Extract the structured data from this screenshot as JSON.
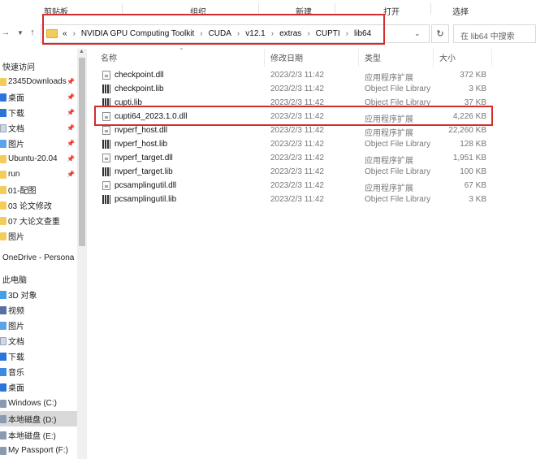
{
  "ribbon": {
    "groups": [
      "剪贴板",
      "组织",
      "新建",
      "打开",
      "选择"
    ]
  },
  "address": {
    "overflow": "«",
    "breadcrumbs": [
      "NVIDIA GPU Computing Toolkit",
      "CUDA",
      "v12.1",
      "extras",
      "CUPTI",
      "lib64"
    ],
    "search_placeholder": "在 lib64 中搜索"
  },
  "sidebar": {
    "quick_access_label": "快速访问",
    "quick_items": [
      {
        "label": "2345Downloads",
        "icon": "folder-icon",
        "pinned": true
      },
      {
        "label": "桌面",
        "icon": "desktop-icon",
        "pinned": true
      },
      {
        "label": "下载",
        "icon": "download-icon",
        "pinned": true
      },
      {
        "label": "文档",
        "icon": "documents-icon",
        "pinned": true
      },
      {
        "label": "图片",
        "icon": "pictures-icon",
        "pinned": true
      },
      {
        "label": "Ubuntu-20.04",
        "icon": "folder-icon",
        "pinned": true
      },
      {
        "label": "run",
        "icon": "folder-icon",
        "pinned": true
      },
      {
        "label": "01-配图",
        "icon": "folder-icon",
        "pinned": false
      },
      {
        "label": "03 论文修改",
        "icon": "folder-icon",
        "pinned": false
      },
      {
        "label": "07 大论文查重",
        "icon": "folder-icon",
        "pinned": false
      },
      {
        "label": "图片",
        "icon": "folder-icon",
        "pinned": false
      }
    ],
    "onedrive_label": "OneDrive - Persona",
    "this_pc_label": "此电脑",
    "pc_items": [
      {
        "label": "3D 对象",
        "icon": "3d-objects-icon"
      },
      {
        "label": "视频",
        "icon": "videos-icon"
      },
      {
        "label": "图片",
        "icon": "pictures-icon"
      },
      {
        "label": "文档",
        "icon": "documents-icon"
      },
      {
        "label": "下载",
        "icon": "download-icon"
      },
      {
        "label": "音乐",
        "icon": "music-icon"
      },
      {
        "label": "桌面",
        "icon": "desktop-icon"
      },
      {
        "label": "Windows (C:)",
        "icon": "drive-icon"
      },
      {
        "label": "本地磁盘 (D:)",
        "icon": "drive-icon",
        "selected": true
      },
      {
        "label": "本地磁盘 (E:)",
        "icon": "drive-icon"
      },
      {
        "label": "My Passport (F:)",
        "icon": "drive-icon"
      }
    ]
  },
  "columns": {
    "name": "名称",
    "date": "修改日期",
    "type": "类型",
    "size": "大小"
  },
  "files": [
    {
      "name": "checkpoint.dll",
      "date": "2023/2/3 11:42",
      "type": "应用程序扩展",
      "size": "372 KB",
      "kind": "dll"
    },
    {
      "name": "checkpoint.lib",
      "date": "2023/2/3 11:42",
      "type": "Object File Library",
      "size": "3 KB",
      "kind": "lib"
    },
    {
      "name": "cupti.lib",
      "date": "2023/2/3 11:42",
      "type": "Object File Library",
      "size": "37 KB",
      "kind": "lib"
    },
    {
      "name": "cupti64_2023.1.0.dll",
      "date": "2023/2/3 11:42",
      "type": "应用程序扩展",
      "size": "4,226 KB",
      "kind": "dll",
      "highlighted": true
    },
    {
      "name": "nvperf_host.dll",
      "date": "2023/2/3 11:42",
      "type": "应用程序扩展",
      "size": "22,260 KB",
      "kind": "dll"
    },
    {
      "name": "nvperf_host.lib",
      "date": "2023/2/3 11:42",
      "type": "Object File Library",
      "size": "128 KB",
      "kind": "lib"
    },
    {
      "name": "nvperf_target.dll",
      "date": "2023/2/3 11:42",
      "type": "应用程序扩展",
      "size": "1,951 KB",
      "kind": "dll"
    },
    {
      "name": "nvperf_target.lib",
      "date": "2023/2/3 11:42",
      "type": "Object File Library",
      "size": "100 KB",
      "kind": "lib"
    },
    {
      "name": "pcsamplingutil.dll",
      "date": "2023/2/3 11:42",
      "type": "应用程序扩展",
      "size": "67 KB",
      "kind": "dll"
    },
    {
      "name": "pcsamplingutil.lib",
      "date": "2023/2/3 11:42",
      "type": "Object File Library",
      "size": "3 KB",
      "kind": "lib"
    }
  ],
  "colors": {
    "highlight_box": "#d62b2b",
    "folder": "#f3cd5a",
    "selection": "#d9d9d9"
  }
}
